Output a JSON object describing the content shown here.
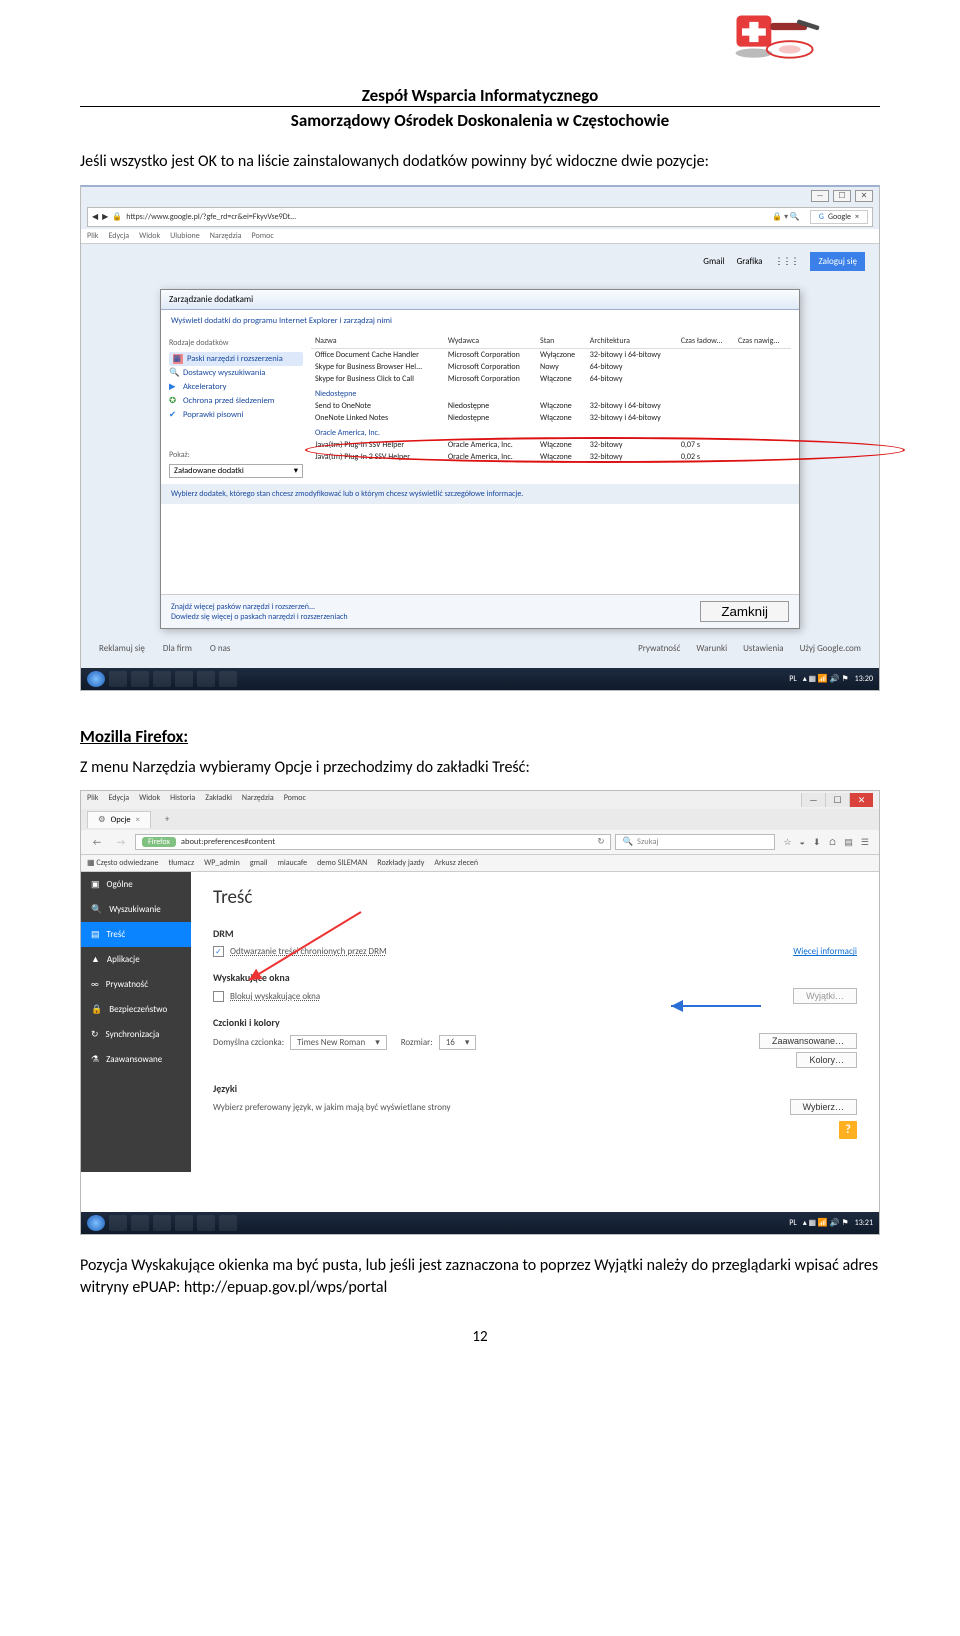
{
  "header": {
    "line1": "Zespół Wsparcia Informatycznego",
    "line2": "Samorządowy Ośrodek Doskonalenia w Częstochowie"
  },
  "intro": "Jeśli wszystko jest OK to na liście zainstalowanych dodatków powinny być widoczne dwie pozycje:",
  "ie": {
    "win_min": "—",
    "win_max": "☐",
    "win_close": "✕",
    "url": "https://www.google.pl/?gfe_rd=cr&ei=FkyvVse9Dt…",
    "sec": "🔒",
    "tab": "Google",
    "tabx": "×",
    "menus": [
      "Plik",
      "Edycja",
      "Widok",
      "Ulubione",
      "Narzędzia",
      "Pomoc"
    ],
    "right": [
      "Gmail",
      "Grafika"
    ],
    "apps": "⋮⋮⋮",
    "signin": "Zaloguj się",
    "dlg_title": "Zarządzanie dodatkami",
    "dlg_sub": "Wyświetl dodatki do programu Internet Explorer i zarządzaj nimi",
    "side_label": "Rodzaje dodatków",
    "side_items": [
      "Paski narzędzi i rozszerzenia",
      "Dostawcy wyszukiwania",
      "Akceleratory",
      "Ochrona przed śledzeniem",
      "Poprawki pisowni"
    ],
    "show_lbl": "Pokaż:",
    "show_val": "Załadowane dodatki",
    "cols": [
      "Nazwa",
      "Wydawca",
      "Stan",
      "Architektura",
      "Czas ładow...",
      "Czas nawig..."
    ],
    "rows": [
      {
        "n": "Office Document Cache Handler",
        "p": "Microsoft Corporation",
        "s": "Wyłączone",
        "a": "32-bitowy i 64-bitowy",
        "l": "",
        "t": ""
      },
      {
        "n": "Skype for Business Browser Hel...",
        "p": "Microsoft Corporation",
        "s": "Nowy",
        "a": "64-bitowy",
        "l": "",
        "t": ""
      },
      {
        "n": "Skype for Business Click to Call",
        "p": "Microsoft Corporation",
        "s": "Włączone",
        "a": "64-bitowy",
        "l": "",
        "t": ""
      }
    ],
    "grp1": "Niedostępne",
    "rows2": [
      {
        "n": "Send to OneNote",
        "p": "Niedostępne",
        "s": "Włączone",
        "a": "32-bitowy i 64-bitowy",
        "l": "",
        "t": ""
      },
      {
        "n": "OneNote Linked Notes",
        "p": "Niedostępne",
        "s": "Włączone",
        "a": "32-bitowy i 64-bitowy",
        "l": "",
        "t": ""
      }
    ],
    "grp2": "Oracle America, Inc.",
    "rows3": [
      {
        "n": "Java(tm) Plug-In SSV Helper",
        "p": "Oracle America, Inc.",
        "s": "Włączone",
        "a": "32-bitowy",
        "l": "0,07 s",
        "t": ""
      },
      {
        "n": "Java(tm) Plug-In 2 SSV Helper",
        "p": "Oracle America, Inc.",
        "s": "Włączone",
        "a": "32-bitowy",
        "l": "0,02 s",
        "t": ""
      }
    ],
    "infobar": "Wybierz dodatek, którego stan chcesz zmodyfikować lub o którym chcesz wyświetlić szczegółowe informacje.",
    "foot1": "Znajdź więcej pasków narzędzi i rozszerzeń...",
    "foot2": "Dowiedz się więcej o paskach narzędzi i rozszerzeniach",
    "close": "Zamknij",
    "gfoot_l": [
      "Reklamuj się",
      "Dla firm",
      "O nas"
    ],
    "gfoot_r": [
      "Prywatność",
      "Warunki",
      "Ustawienia",
      "Użyj Google.com"
    ],
    "clock": "13:20",
    "lang": "PL"
  },
  "ff_heading": "Mozilla Firefox:",
  "ff_text": "Z menu Narzędzia wybieramy Opcje i przechodzimy do zakładki Treść:",
  "ff": {
    "menus": [
      "Plik",
      "Edycja",
      "Widok",
      "Historia",
      "Zakładki",
      "Narzędzia",
      "Pomoc"
    ],
    "tab": "Opcje",
    "tabx": "×",
    "plus": "+",
    "back": "←",
    "fwd": "→",
    "ffpill": "Firefox",
    "url": "about:preferences#content",
    "reload": "↻",
    "search_ph": "Szukaj",
    "ico_star": "☆",
    "ico_dl": "⬇",
    "ico_home": "⌂",
    "ico_book": "▤",
    "ico_menu": "☰",
    "ico_pocket": "◒",
    "bmk_lbl": "Często odwiedzane",
    "bmks": [
      "tłumacz",
      "WP_admin",
      "gmail",
      "miaucafe",
      "demo SILEMAN",
      "Rozkłady jazdy",
      "Arkusz zleceń"
    ],
    "side": [
      {
        "ico": "▣",
        "lbl": "Ogólne"
      },
      {
        "ico": "🔍",
        "lbl": "Wyszukiwanie"
      },
      {
        "ico": "▤",
        "lbl": "Treść",
        "sel": true
      },
      {
        "ico": "▲",
        "lbl": "Aplikacje"
      },
      {
        "ico": "∞",
        "lbl": "Prywatność"
      },
      {
        "ico": "🔒",
        "lbl": "Bezpieczeństwo"
      },
      {
        "ico": "↻",
        "lbl": "Synchronizacja"
      },
      {
        "ico": "⚗",
        "lbl": "Zaawansowane"
      }
    ],
    "h": "Treść",
    "s_drm": "DRM",
    "r_drm": "Odtwarzanie treści chronionych przez DRM",
    "drm_chk": "✓",
    "link_more": "Więcej informacji",
    "s_pop": "Wyskakujące okna",
    "r_pop": "Blokuj wyskakujące okna",
    "btn_exc": "Wyjątki…",
    "s_font": "Czcionki i kolory",
    "lbl_deffont": "Domyślna czcionka:",
    "val_font": "Times New Roman",
    "lbl_size": "Rozmiar:",
    "val_size": "16",
    "btn_adv": "Zaawansowane…",
    "btn_col": "Kolory…",
    "s_lang": "Języki",
    "r_lang": "Wybierz preferowany język, w jakim mają być wyświetlane strony",
    "btn_pick": "Wybierz…",
    "help": "?",
    "clock": "13:21",
    "lang": "PL"
  },
  "outro": "Pozycja Wyskakujące okienka ma być pusta, lub jeśli jest zaznaczona to poprzez Wyjątki należy do przeglądarki wpisać adres witryny ePUAP: http://epuap.gov.pl/wps/portal",
  "page": "12"
}
